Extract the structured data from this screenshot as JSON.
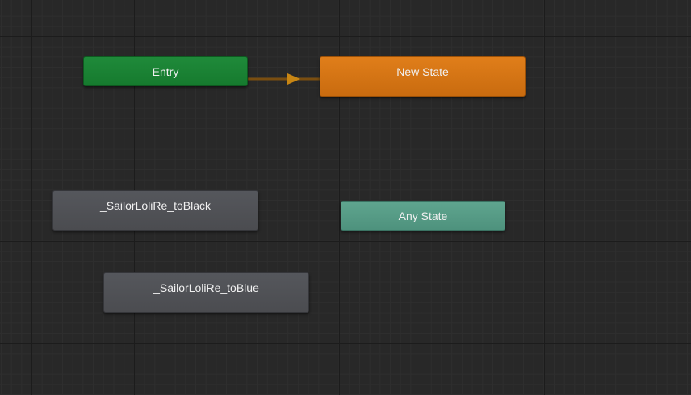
{
  "graph": {
    "nodes": {
      "entry": {
        "label": "Entry",
        "color": "#1a8234"
      },
      "new_state": {
        "label": "New State",
        "color": "#d4761a"
      },
      "any_state": {
        "label": "Any State",
        "color": "#579c87"
      },
      "to_black": {
        "label": "_SailorLoliRe_toBlack",
        "color": "#505155"
      },
      "to_blue": {
        "label": "_SailorLoliRe_toBlue",
        "color": "#505155"
      }
    },
    "transition": {
      "from": "Entry",
      "to": "New State",
      "color": "#a86c12"
    }
  }
}
